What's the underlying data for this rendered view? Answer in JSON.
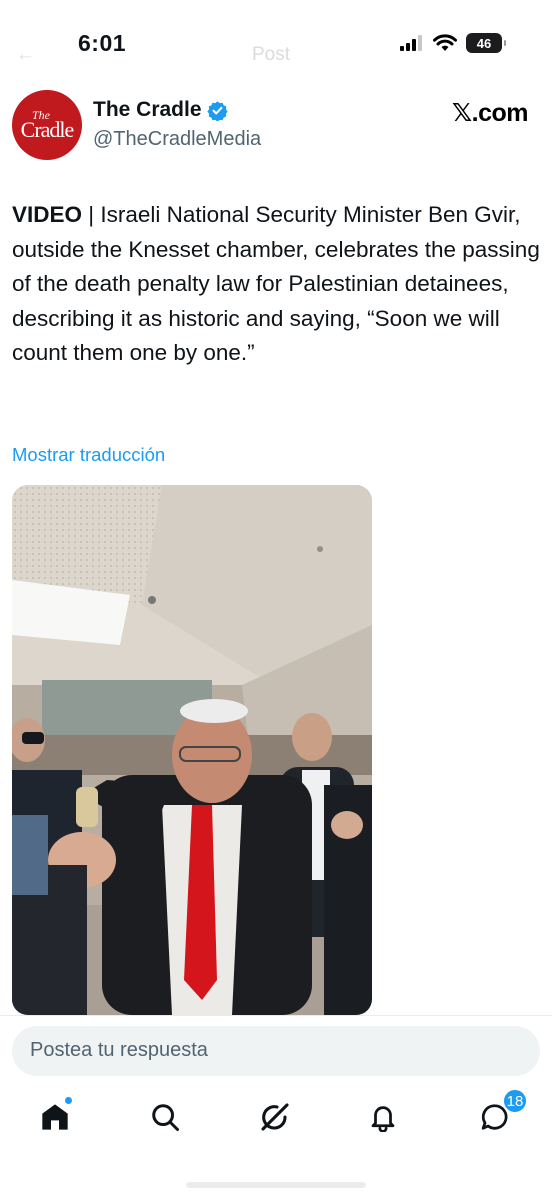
{
  "status_bar": {
    "time": "6:01",
    "battery": "46",
    "signal_icon": "cellular-signal-icon",
    "wifi_icon": "wifi-icon"
  },
  "background_nav": {
    "title": "Post",
    "back_icon": "back-arrow-icon"
  },
  "tweet": {
    "author": {
      "name": "The Cradle",
      "handle": "@TheCradleMedia",
      "verified": true,
      "avatar_text_small": "The",
      "avatar_text_large": "Cradle"
    },
    "brand": "𝕏.com",
    "text_lead": "VIDEO",
    "text_body": " | Israeli National Security Minister Ben Gvir, outside the Knesset chamber, celebrates the passing of the death penalty law for Palestinian detainees, describing it as historic and saying, “Soon we will count them one by one.”",
    "translate_label": "Mostrar traducción",
    "media_type": "video-thumbnail"
  },
  "reply": {
    "placeholder": "Postea tu respuesta"
  },
  "bottom_nav": {
    "items": [
      {
        "name": "home",
        "icon": "home-icon",
        "active": true
      },
      {
        "name": "search",
        "icon": "search-icon"
      },
      {
        "name": "grok",
        "icon": "grok-icon"
      },
      {
        "name": "notifications",
        "icon": "bell-icon"
      },
      {
        "name": "messages",
        "icon": "messages-icon",
        "badge": "18"
      }
    ]
  },
  "colors": {
    "accent": "#1d9bf0",
    "avatar_bg": "#c0191e",
    "text": "#0f1419",
    "secondary_text": "#536471"
  }
}
